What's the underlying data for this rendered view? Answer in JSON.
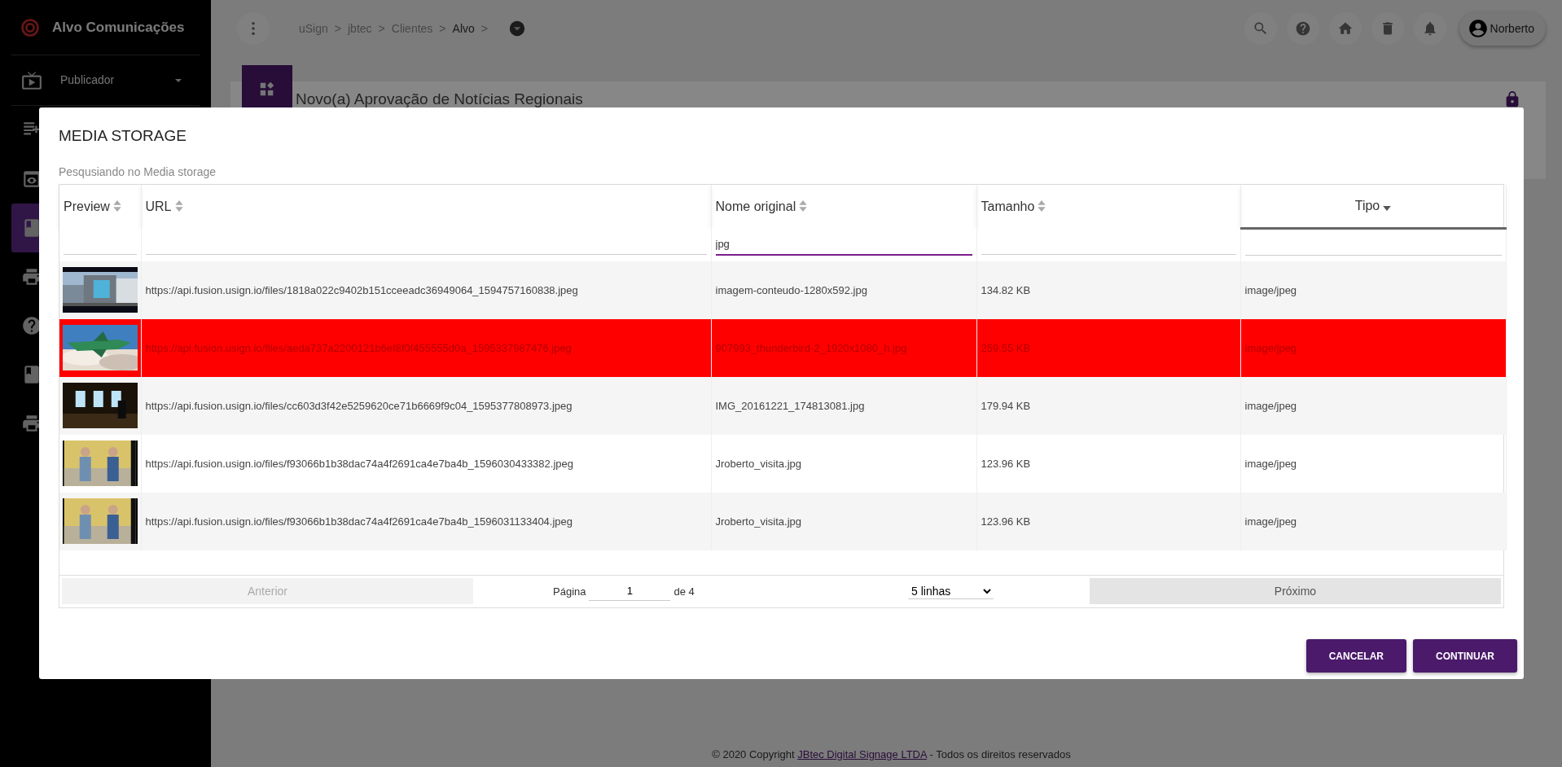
{
  "sidebar": {
    "brand": "Alvo Comunicações",
    "items": [
      {
        "label": "Publicador",
        "selected": false,
        "expanded": false
      },
      {
        "selected": false
      },
      {
        "selected": false
      },
      {
        "selected": true
      },
      {
        "selected": false
      },
      {
        "selected": false
      },
      {
        "selected": false
      },
      {
        "selected": false
      }
    ]
  },
  "topbar": {
    "breadcrumbs": [
      {
        "label": "uSign",
        "current": false
      },
      {
        "label": "jbtec",
        "current": false
      },
      {
        "label": "Clientes",
        "current": false
      },
      {
        "label": "Alvo",
        "current": true
      }
    ],
    "separator": ">",
    "user": "Norberto"
  },
  "card": {
    "title": "Novo(a) Aprovação de Notícias Regionais"
  },
  "footer": {
    "prefix": "© 2020 Copyright",
    "link": "JBtec Digital Signage LTDA",
    "suffix": " - Todos os direitos reservados"
  },
  "modal": {
    "title": "MEDIA STORAGE",
    "subtitle": "Pesqusiando no Media storage",
    "table": {
      "columns": [
        {
          "label": "Preview",
          "sorted": false
        },
        {
          "label": "URL",
          "sorted": false
        },
        {
          "label": "Nome original",
          "sorted": false
        },
        {
          "label": "Tamanho",
          "sorted": false
        },
        {
          "label": "Tipo",
          "sorted": true
        }
      ],
      "filters": [
        {
          "focused": false
        },
        {
          "focused": false
        },
        {
          "value": "jpg",
          "focused": true
        },
        {
          "focused": false
        },
        {
          "focused": false
        }
      ],
      "rows": [
        {
          "url": "https://api.fusion.usign.io/files/1818a022c9402b151cceeadc36949064_1594757160838.jpeg",
          "name": "imagem-conteudo-1280x592.jpg",
          "size": "134.82 KB",
          "type": "image/jpeg",
          "selected": false
        },
        {
          "url": "https://api.fusion.usign.io/files/aeda737a2200121b6ef8f0f455555d0a_1595337987476.jpeg",
          "name": "907993_thunderbird-2_1920x1080_h.jpg",
          "size": "259.55 KB",
          "type": "image/jpeg",
          "selected": true
        },
        {
          "url": "https://api.fusion.usign.io/files/cc603d3f42e5259620ce71b6669f9c04_1595377808973.jpeg",
          "name": "IMG_20161221_174813081.jpg",
          "size": "179.94 KB",
          "type": "image/jpeg",
          "selected": false
        },
        {
          "url": "https://api.fusion.usign.io/files/f93066b1b38dac74a4f2691ca4e7ba4b_1596030433382.jpeg",
          "name": "Jroberto_visita.jpg",
          "size": "123.96 KB",
          "type": "image/jpeg",
          "selected": false
        },
        {
          "url": "https://api.fusion.usign.io/files/f93066b1b38dac74a4f2691ca4e7ba4b_1596031133404.jpeg",
          "name": "Jroberto_visita.jpg",
          "size": "123.96 KB",
          "type": "image/jpeg",
          "selected": false
        }
      ]
    },
    "pagination": {
      "previous": {
        "label": "Anterior",
        "disabled": true
      },
      "page_label": "Página",
      "page": "1",
      "of": "de 4",
      "rows_option": "5 linhas",
      "next": {
        "label": "Próximo",
        "disabled": false
      }
    },
    "buttons": [
      "CANCELAR",
      "CONTINUAR"
    ]
  }
}
